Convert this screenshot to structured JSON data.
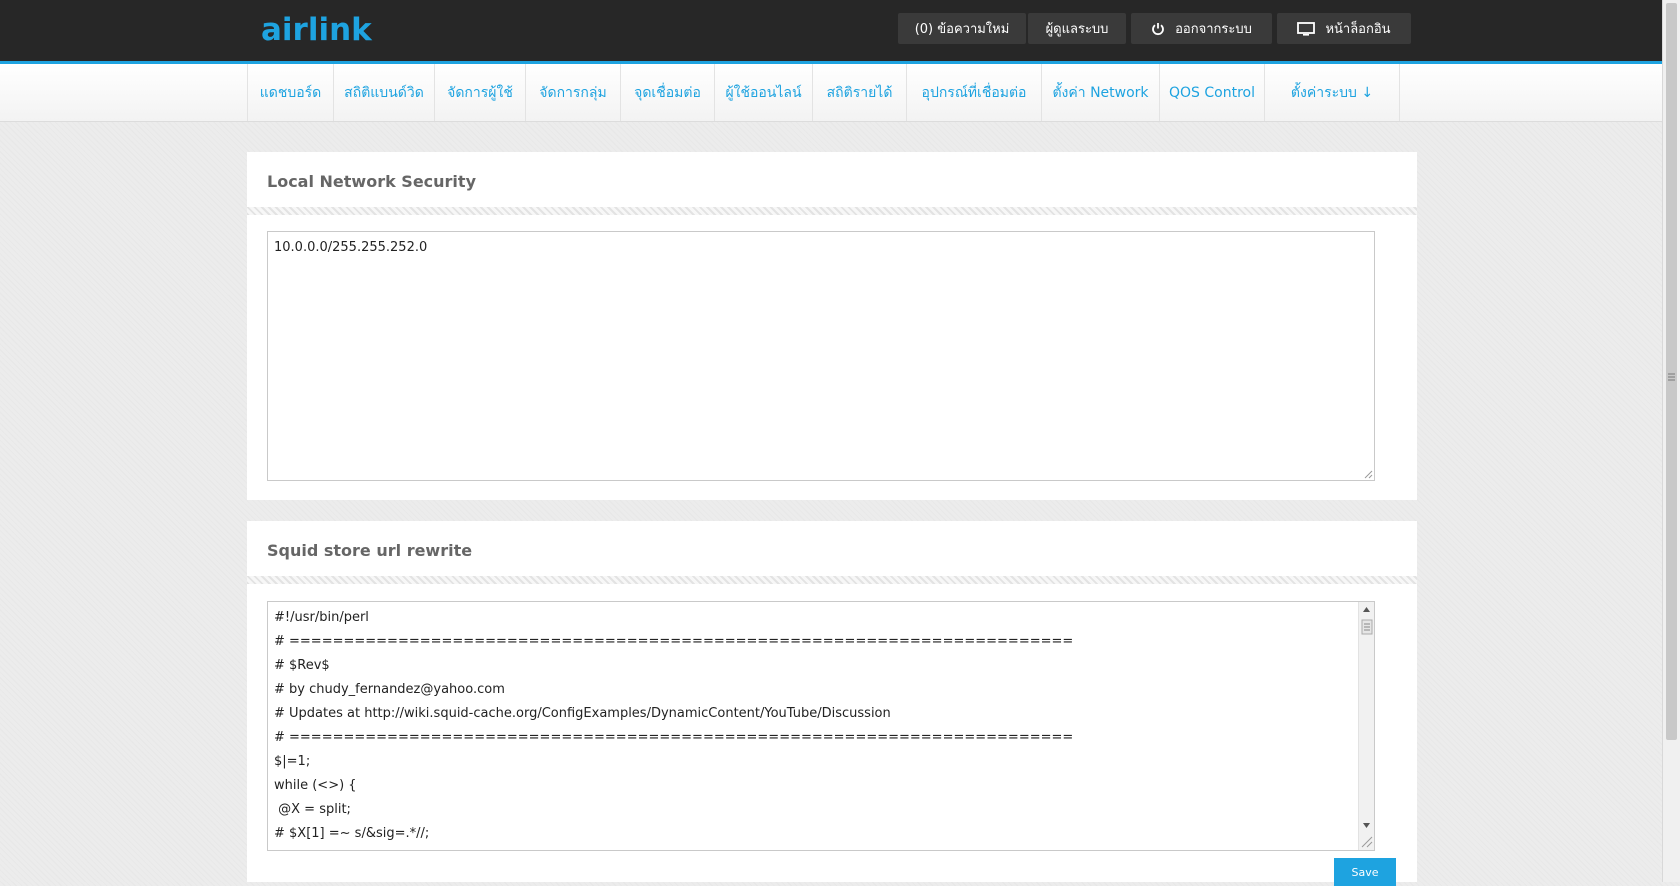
{
  "brand": {
    "logo_text": "airlink",
    "accent": "#1ea3e0"
  },
  "top_buttons": [
    {
      "label": "(0) ข้อความใหม่",
      "icon": ""
    },
    {
      "label": "ผู้ดูแลระบบ",
      "icon": ""
    },
    {
      "label": "ออกจากระบบ",
      "icon": "power-icon"
    },
    {
      "label": "หน้าล็อกอิน",
      "icon": "monitor-icon"
    }
  ],
  "nav": [
    {
      "label": "แดชบอร์ด"
    },
    {
      "label": "สถิติแบนด์วิด"
    },
    {
      "label": "จัดการผู้ใช้"
    },
    {
      "label": "จัดการกลุ่ม"
    },
    {
      "label": "จุดเชื่อมต่อ"
    },
    {
      "label": "ผู้ใช้ออนไลน์"
    },
    {
      "label": "สถิติรายได้"
    },
    {
      "label": "อุปกรณ์ที่เชื่อมต่อ"
    },
    {
      "label": "ตั้งค่า Network"
    },
    {
      "label": "QOS Control"
    },
    {
      "label": "ตั้งค่าระบบ ↓"
    }
  ],
  "panels": {
    "local_network": {
      "title": "Local Network Security",
      "value": "10.0.0.0/255.255.252.0"
    },
    "squid": {
      "title": "Squid store url rewrite",
      "lines": [
        "#!/usr/bin/perl",
        "# ========================================================================",
        "# $Rev$",
        "# by chudy_fernandez@yahoo.com",
        "# Updates at http://wiki.squid-cache.org/ConfigExamples/DynamicContent/YouTube/Discussion",
        "# ========================================================================",
        "$|=1;",
        "while (<>) {",
        " @X = split;",
        "# $X[1] =~ s/&sig=.*//;"
      ],
      "save_label": "Save"
    }
  }
}
